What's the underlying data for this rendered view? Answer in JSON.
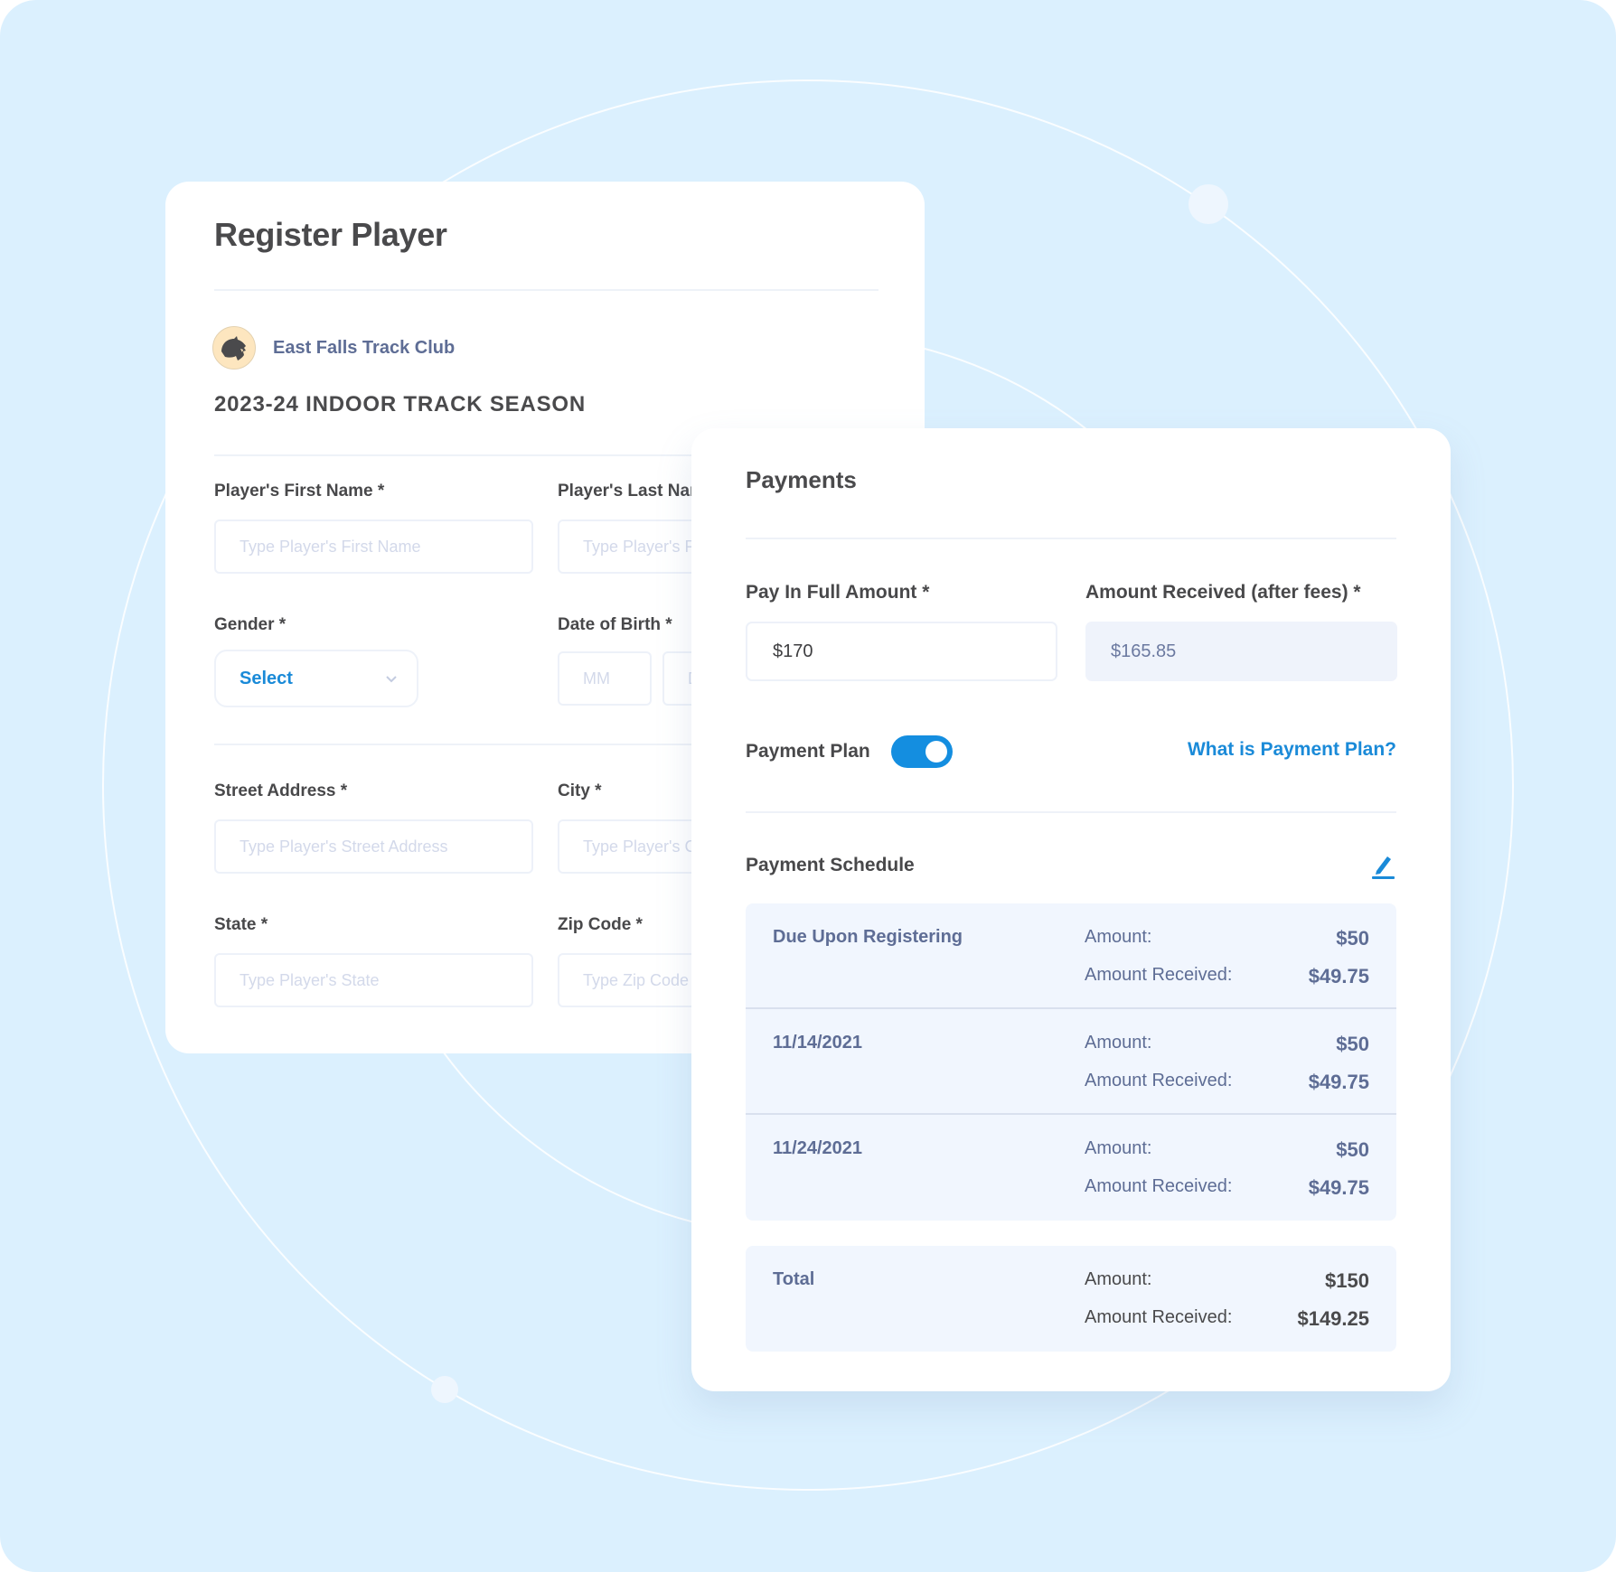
{
  "register": {
    "title": "Register Player",
    "club_name": "East Falls Track Club",
    "club_logo_icon": "panther-icon",
    "season": "2023-24 INDOOR TRACK SEASON",
    "fields": {
      "first_name": {
        "label": "Player's First Name *",
        "placeholder": "Type Player's First Name"
      },
      "last_name": {
        "label": "Player's Last Name *",
        "placeholder": "Type Player's First Name"
      },
      "gender": {
        "label": "Gender *",
        "value": "Select"
      },
      "dob": {
        "label": "Date of Birth *",
        "mm_placeholder": "MM",
        "dd_placeholder": "DD"
      },
      "street": {
        "label": "Street Address *",
        "placeholder": "Type Player's Street Address"
      },
      "city": {
        "label": "City *",
        "placeholder": "Type Player's City"
      },
      "state": {
        "label": "State *",
        "placeholder": "Type Player's State"
      },
      "zip": {
        "label": "Zip Code *",
        "placeholder": "Type Zip Code"
      }
    }
  },
  "payments": {
    "title": "Payments",
    "pay_in_full": {
      "label": "Pay In Full Amount *",
      "value": "$170"
    },
    "amount_received": {
      "label": "Amount Received (after fees) *",
      "value": "$165.85"
    },
    "payment_plan": {
      "label": "Payment Plan",
      "enabled": true,
      "help_link": "What is Payment Plan?"
    },
    "schedule_title": "Payment Schedule",
    "amount_label": "Amount:",
    "received_label": "Amount Received:",
    "schedule": [
      {
        "name": "Due Upon Registering",
        "amount": "$50",
        "received": "$49.75"
      },
      {
        "name": "11/14/2021",
        "amount": "$50",
        "received": "$49.75"
      },
      {
        "name": "11/24/2021",
        "amount": "$50",
        "received": "$49.75"
      }
    ],
    "total": {
      "name": "Total",
      "amount": "$150",
      "received": "$149.25"
    }
  },
  "colors": {
    "background": "#dbf0fe",
    "accent": "#148ee0",
    "link": "#1a8ad8",
    "muted_text": "#5e6d95"
  }
}
